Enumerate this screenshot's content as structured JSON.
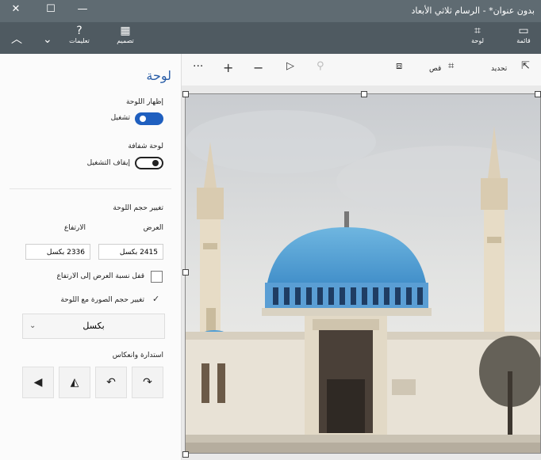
{
  "window": {
    "title": "بدون عنوان* - الرسام ثلاثي الأبعاد",
    "controls": [
      "✕",
      "☐",
      "—"
    ]
  },
  "ribbon": {
    "items": [
      {
        "label": "",
        "icon": "chevron-up-icon"
      },
      {
        "label": "",
        "icon": "chevron-down-icon"
      },
      {
        "label": "تعليمات",
        "icon": "help-icon"
      },
      {
        "label": "تصميم",
        "icon": "design-icon"
      },
      {
        "label": "لوحة",
        "icon": "canvas-icon"
      },
      {
        "label": "قائمة",
        "icon": "menu-icon"
      }
    ]
  },
  "panel": {
    "title": "لوحة",
    "show_canvas": {
      "label": "إظهار اللوحة",
      "toggle_text": "تشغيل",
      "on": true
    },
    "transparent_canvas": {
      "label": "لوحة شفافة",
      "toggle_text": "إيقاف التشغيل",
      "on": false
    },
    "resize": {
      "heading": "تغيير حجم اللوحة",
      "width_label": "العرض",
      "height_label": "الارتفاع",
      "width_value": "2415 بكسل",
      "height_value": "2336 بكسل",
      "lock_ratio": "قفل نسبة العرض إلى الارتفاع",
      "resize_image": "تغيير حجم الصورة مع اللوحة"
    },
    "unit": "بكسل",
    "rotate_flip": "استدارة وانعكاس"
  },
  "toolbar": {
    "select_label": "تحديد",
    "crop_label": "قص",
    "more": "···",
    "zoom_in": "+",
    "zoom_out": "−"
  }
}
